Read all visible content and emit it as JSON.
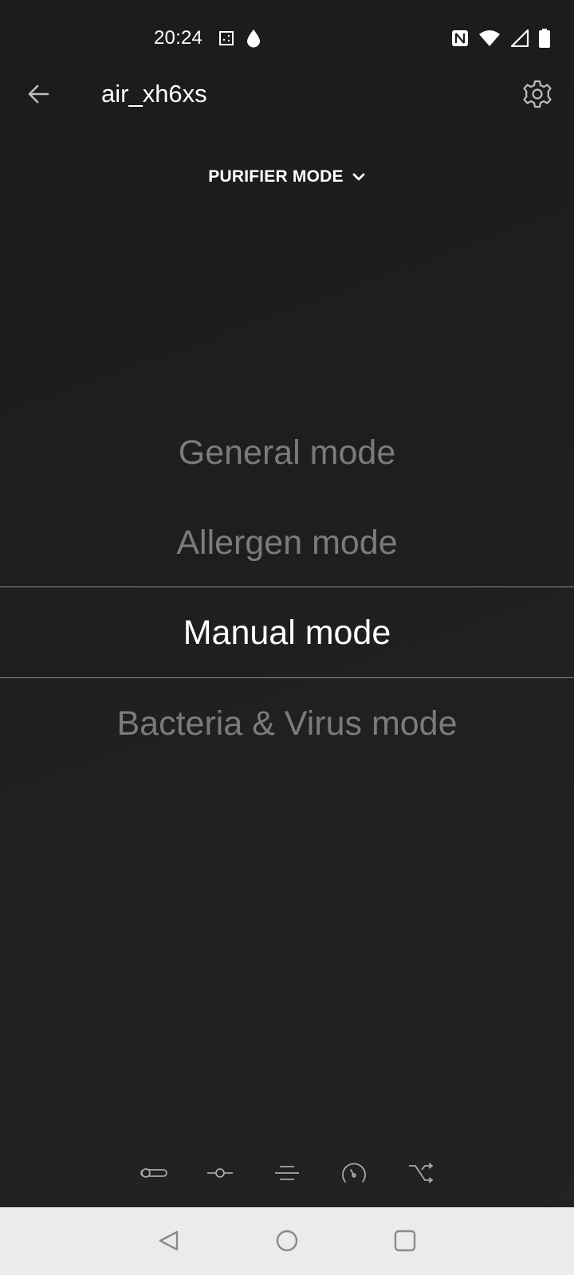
{
  "status_bar": {
    "time": "20:24",
    "icons": [
      "screenshot-icon",
      "water-drop-icon",
      "nfc-icon",
      "wifi-icon",
      "cell-signal-icon",
      "battery-icon"
    ]
  },
  "app_bar": {
    "title": "air_xh6xs",
    "back_icon": "arrow-left-icon",
    "settings_icon": "gear-icon"
  },
  "mode_selector": {
    "label": "PURIFIER MODE",
    "icon": "chevron-down-icon"
  },
  "modes": {
    "items": [
      "General mode",
      "Allergen mode",
      "Manual mode",
      "Bacteria & Virus mode"
    ],
    "selected": "Manual mode"
  },
  "tools": {
    "icons": [
      "toggle-icon",
      "slider-icon",
      "lines-icon",
      "speedometer-icon",
      "shuffle-icon"
    ]
  },
  "nav_bar": {
    "icons": [
      "back-triangle-icon",
      "home-circle-icon",
      "recents-square-icon"
    ]
  },
  "colors": {
    "background": "#1e1e1e",
    "text_primary": "#ffffff",
    "text_dimmed": "#7b7b7b",
    "nav_bar": "#ebebeb"
  }
}
